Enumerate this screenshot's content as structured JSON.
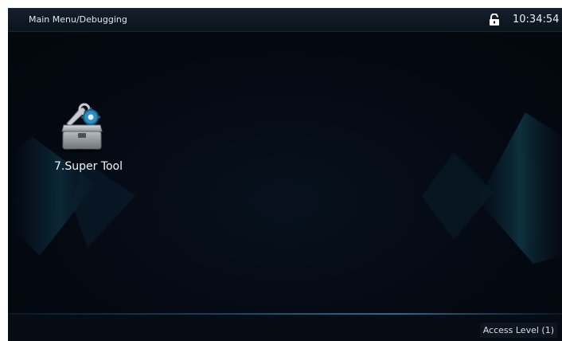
{
  "header": {
    "breadcrumb": "Main Menu/Debugging",
    "lock_icon": "unlocked-padlock-icon",
    "time": "10:34:54"
  },
  "apps": [
    {
      "label": "7.Super Tool",
      "icon": "toolbox-wrench-gear-icon"
    }
  ],
  "footer": {
    "access_level": "Access Level  (1)"
  },
  "colors": {
    "background": "#050a14",
    "header": "#101a24",
    "text": "#e8eef5",
    "accent": "#2d6a8e"
  }
}
